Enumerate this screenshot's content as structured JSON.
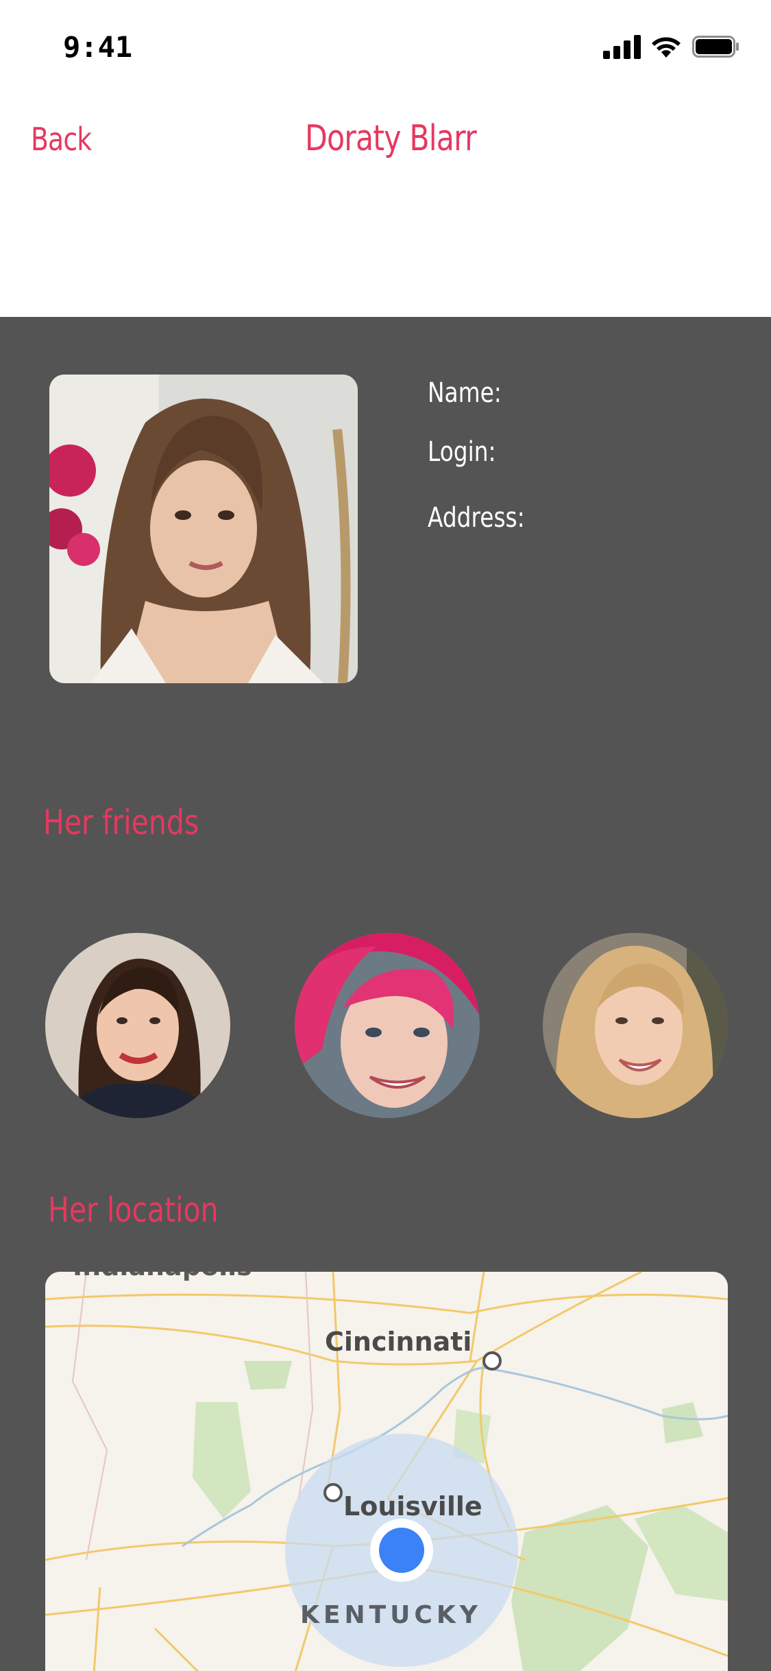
{
  "status_bar": {
    "time": "9:41"
  },
  "nav": {
    "back_label": "Back",
    "title": "Doraty Blarr"
  },
  "profile": {
    "name_label": "Name:",
    "login_label": "Login:",
    "address_label": "Address:"
  },
  "friends": {
    "title": "Her friends"
  },
  "location": {
    "title": "Her location",
    "map": {
      "city_1": "Cincinnati",
      "city_2": "Louisville",
      "state": "KENTUCKY",
      "city_partial": "Indianapolis"
    }
  },
  "colors": {
    "accent": "#e6385f",
    "background": "#545454",
    "header": "#ffffff",
    "map_pin": "#3b82f6"
  }
}
